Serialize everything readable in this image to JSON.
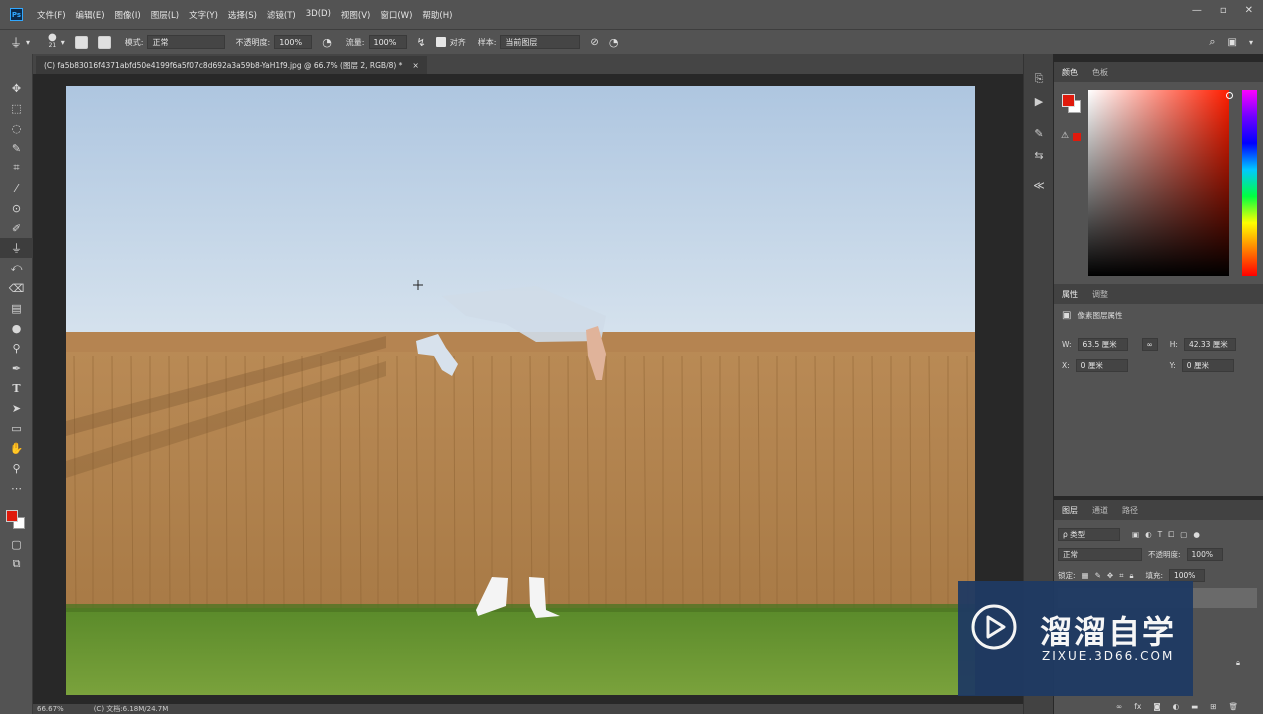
{
  "app": {
    "logo_text": "Ps"
  },
  "menu": [
    "文件(F)",
    "编辑(E)",
    "图像(I)",
    "图层(L)",
    "文字(Y)",
    "选择(S)",
    "滤镜(T)",
    "3D(D)",
    "视图(V)",
    "窗口(W)",
    "帮助(H)"
  ],
  "window_controls": {
    "minimize": "—",
    "restore": "▫",
    "close": "✕"
  },
  "options": {
    "brush_size": "21",
    "mode_label": "模式:",
    "mode_value": "正常",
    "opacity_label": "不透明度:",
    "opacity_value": "100%",
    "flow_label": "流量:",
    "flow_value": "100%",
    "aligned_label": "对齐",
    "sample_label": "样本:",
    "sample_value": "当前图层"
  },
  "document": {
    "tab_title": "(C) fa5b83016f4371abfd50e4199f6a5f07c8d692a3a59b8-YaH1f9.jpg @ 66.7% (图层 2, RGB/8) *",
    "close": "×"
  },
  "status": {
    "zoom": "66.67%",
    "doc_size": "(C) 文档:6.18M/24.7M"
  },
  "color_panel": {
    "tabs": [
      "颜色",
      "色板"
    ]
  },
  "properties_panel": {
    "tabs": [
      "属性",
      "调整"
    ],
    "title": "像素图层属性",
    "w_label": "W:",
    "w_value": "63.5 厘米",
    "h_label": "H:",
    "h_value": "42.33 厘米",
    "x_label": "X:",
    "x_value": "0 厘米",
    "y_label": "Y:",
    "y_value": "0 厘米",
    "link": "∞"
  },
  "layers_panel": {
    "tabs": [
      "图层",
      "通道",
      "路径"
    ],
    "filter_label": "ρ 类型",
    "blend_mode": "正常",
    "opacity_label": "不透明度:",
    "opacity_value": "100%",
    "lock_label": "锁定:",
    "fill_label": "填充:",
    "fill_value": "100%"
  },
  "watermark": {
    "title": "溜溜自学",
    "url": "ZIXUE.3D66.COM"
  },
  "colors": {
    "foreground": "#e01a0c",
    "background": "#ffffff",
    "panel_bg": "#535353",
    "canvas_bg": "#282828"
  }
}
